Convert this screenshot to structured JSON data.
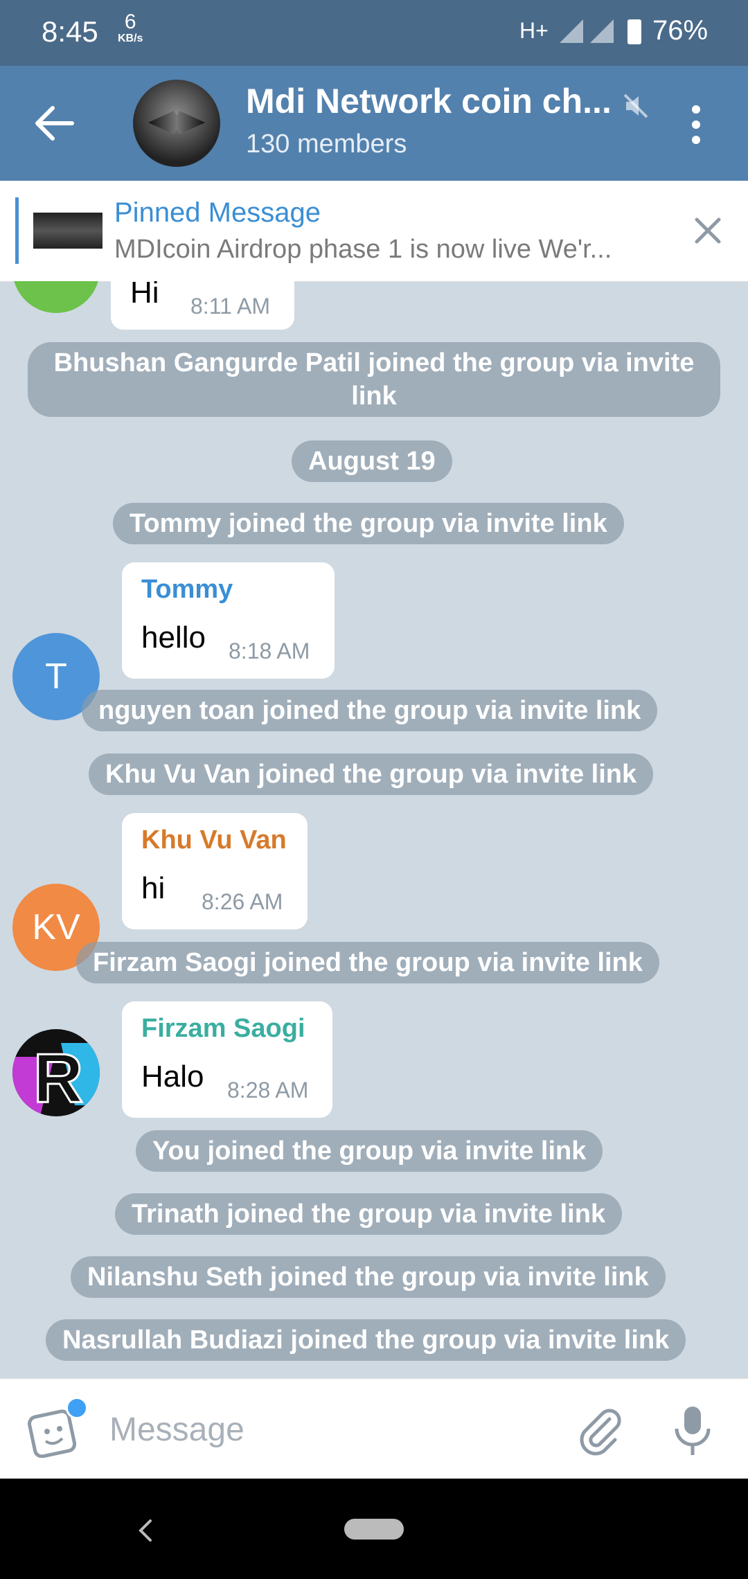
{
  "status": {
    "time": "8:45",
    "speed_value": "6",
    "speed_unit": "KB/s",
    "network": "H+",
    "battery": "76%"
  },
  "header": {
    "title": "Mdi Network coin ch...",
    "subtitle": "130 members"
  },
  "pinned": {
    "title": "Pinned Message",
    "text": "MDIcoin Airdrop phase 1 is now live We'r..."
  },
  "messages": {
    "m0": {
      "text": "Hi",
      "time": "8:11 AM"
    },
    "s1": "Bhushan Gangurde Patil joined the group via invite link",
    "date": "August 19",
    "s2": "Tommy joined the group via invite link",
    "m1": {
      "avatar": "T",
      "name": "Tommy",
      "text": "hello",
      "time": "8:18 AM",
      "color": "#3a8ed4"
    },
    "s3": "nguyen toan joined the group via invite link",
    "s4": "Khu Vu Van joined the group via invite link",
    "m2": {
      "avatar": "KV",
      "name": "Khu Vu Van",
      "text": "hi",
      "time": "8:26 AM",
      "color": "#d67a2a"
    },
    "s5": "Firzam Saogi joined the group via invite link",
    "m3": {
      "name": "Firzam Saogi",
      "text": "Halo",
      "time": "8:28 AM",
      "color": "#3aaea0"
    },
    "s6": "You joined the group via invite link",
    "s7": "Trinath joined the group via invite link",
    "s8": "Nilanshu Seth joined the group via invite link",
    "s9": "Nasrullah Budiazi joined the group via invite link"
  },
  "input": {
    "placeholder": "Message"
  },
  "colors": {
    "header": "#5381ad",
    "statusbar": "#4a6a89",
    "accent": "#3a8ed4"
  }
}
